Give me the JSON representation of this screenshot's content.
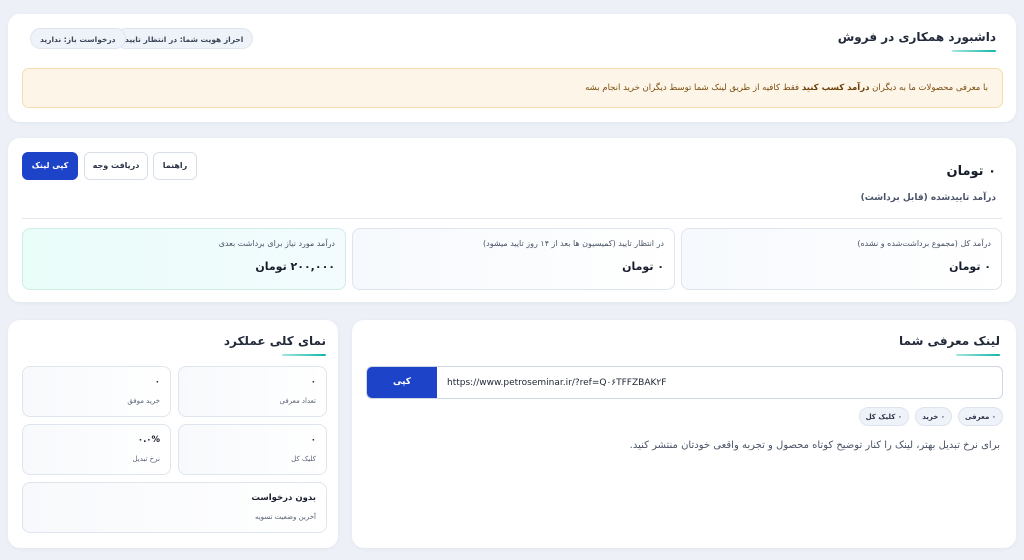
{
  "header": {
    "title": "داشبورد همکاری در فروش",
    "identity_pill": "احراز هویت شما: در انتظار تایید",
    "withdraw_pill": "درخواست باز: ندارید",
    "notice_before": "با معرفی محصولات ما به دیگران ",
    "notice_bold": "درآمد کسب کنید",
    "notice_after": " فقط کافیه از طریق لینک شما توسط دیگران خرید انجام بشه",
    "accent_color": "#10b7a8",
    "notice_bg": "#fdf5e7"
  },
  "income": {
    "amount": "۰ تومان",
    "amount_label": "درآمد تاییدشده (قابل برداشت)",
    "buttons": {
      "guide": "راهنما",
      "payout": "دریافت وجه",
      "copy_link": "کپی لینک"
    },
    "stats": {
      "total_label": "درآمد کل (مجموع برداشت‌شده و نشده)",
      "total_value": "۰ تومان",
      "pending_label": "در انتظار تایید (کمیسیون ها بعد از ۱۴ روز تایید میشود)",
      "pending_value": "۰ تومان",
      "needed_label": "درآمد مورد نیاز برای برداشت بعدی",
      "needed_value": "۲۰۰,۰۰۰ تومان"
    },
    "primary_color": "#1d43c9"
  },
  "link": {
    "title": "لینک معرفی شما",
    "copy_label": "کپی",
    "url": "https://www.petroseminar.ir/?ref=Q۰۶TFFZBAK۲F",
    "pills": {
      "referrals": "۰ معرفی",
      "purchases": "۰ خرید",
      "clicks": "۰ کلیک کل"
    },
    "hint": "برای نرخ تبدیل بهتر، لینک را کنار توضیح کوتاه محصول و تجربه واقعی خودتان منتشر کنید."
  },
  "performance": {
    "title": "نمای کلی عملکرد",
    "referrals_value": "۰",
    "referrals_label": "تعداد معرفی",
    "success_value": "۰",
    "success_label": "خرید موفق",
    "clicks_value": "۰",
    "clicks_label": "کلیک کل",
    "conversion_value": "۰.۰%",
    "conversion_label": "نرخ تبدیل",
    "settlement_value": "بدون درخواست",
    "settlement_label": "آخرین وضعیت تسویه"
  }
}
